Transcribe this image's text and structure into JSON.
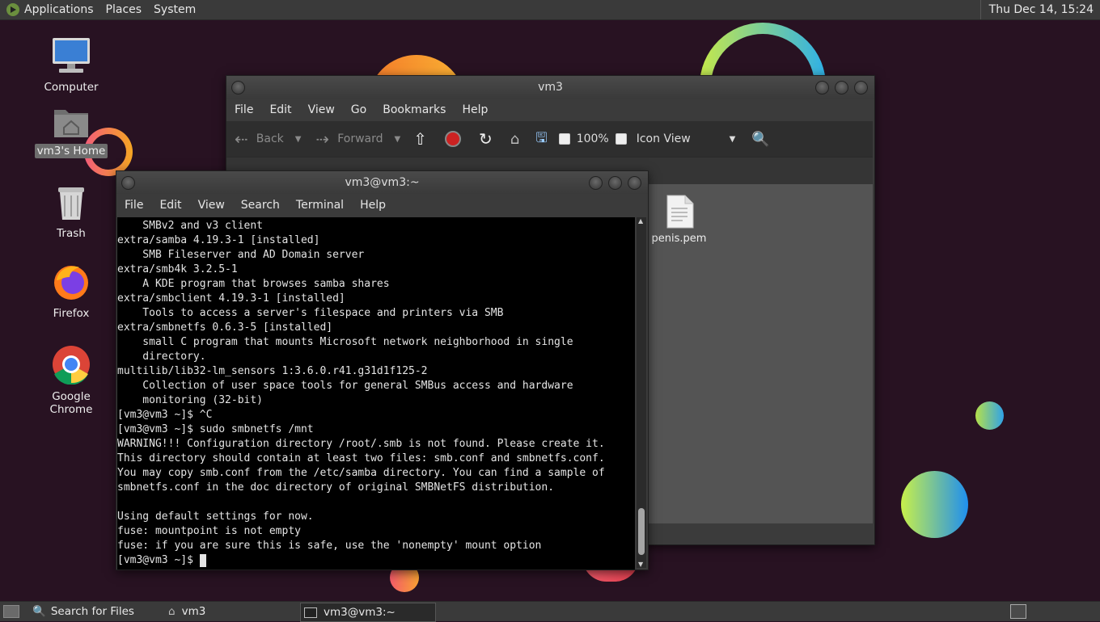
{
  "topbar": {
    "menus": [
      "Applications",
      "Places",
      "System"
    ],
    "clock": "Thu Dec 14, 15:24"
  },
  "desktop_icons": [
    {
      "label": "Computer",
      "icon": "computer-icon"
    },
    {
      "label": "vm3's Home",
      "icon": "home-folder-icon",
      "selected": true
    },
    {
      "label": "Trash",
      "icon": "trash-icon"
    },
    {
      "label": "Firefox",
      "icon": "firefox-icon"
    },
    {
      "label": "Google Chrome",
      "icon": "chrome-icon"
    }
  ],
  "file_manager": {
    "title": "vm3",
    "menus": [
      "File",
      "Edit",
      "View",
      "Go",
      "Bookmarks",
      "Help"
    ],
    "toolbar": {
      "back": "Back",
      "forward": "Forward",
      "zoom": "100%",
      "view_mode": "Icon View"
    },
    "files": [
      {
        "name": "penis.pem",
        "icon": "document-icon"
      }
    ]
  },
  "terminal": {
    "title": "vm3@vm3:~",
    "menus": [
      "File",
      "Edit",
      "View",
      "Search",
      "Terminal",
      "Help"
    ],
    "lines": [
      "    SMBv2 and v3 client",
      "extra/samba 4.19.3-1 [installed]",
      "    SMB Fileserver and AD Domain server",
      "extra/smb4k 3.2.5-1",
      "    A KDE program that browses samba shares",
      "extra/smbclient 4.19.3-1 [installed]",
      "    Tools to access a server's filespace and printers via SMB",
      "extra/smbnetfs 0.6.3-5 [installed]",
      "    small C program that mounts Microsoft network neighborhood in single",
      "    directory.",
      "multilib/lib32-lm_sensors 1:3.6.0.r41.g31d1f125-2",
      "    Collection of user space tools for general SMBus access and hardware",
      "    monitoring (32-bit)",
      "[vm3@vm3 ~]$ ^C",
      "[vm3@vm3 ~]$ sudo smbnetfs /mnt",
      "WARNING!!! Configuration directory /root/.smb is not found. Please create it.",
      "This directory should contain at least two files: smb.conf and smbnetfs.conf.",
      "You may copy smb.conf from the /etc/samba directory. You can find a sample of",
      "smbnetfs.conf in the doc directory of original SMBNetFS distribution.",
      "",
      "Using default settings for now.",
      "fuse: mountpoint is not empty",
      "fuse: if you are sure this is safe, use the 'nonempty' mount option",
      "[vm3@vm3 ~]$ "
    ]
  },
  "taskbar": {
    "items": [
      {
        "label": "Search for Files",
        "icon": "search-icon"
      },
      {
        "label": "vm3",
        "icon": "folder-icon"
      },
      {
        "label": "vm3@vm3:~",
        "icon": "terminal-icon",
        "active": true
      }
    ]
  }
}
